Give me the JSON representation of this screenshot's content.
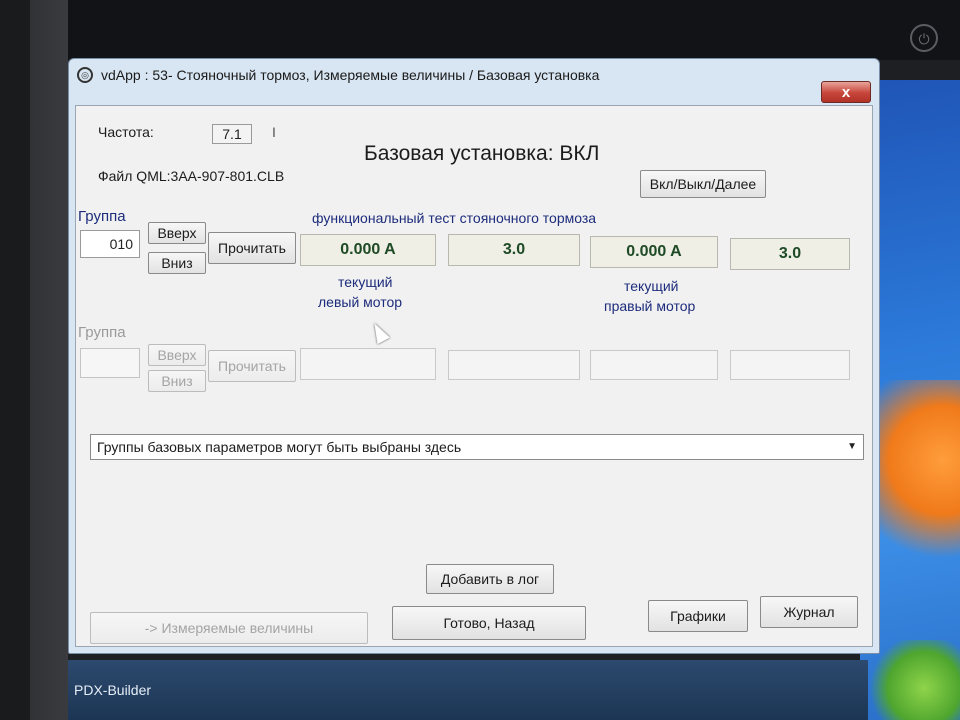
{
  "window": {
    "title": "vdApp : 53- Стояночный тормоз,  Измеряемые величины / Базовая установка",
    "close_label": "x"
  },
  "header": {
    "freq_label": "Частота:",
    "freq_value": "7.1",
    "freq_suffix": "I",
    "file_label": "Файл QML:3AA-907-801.CLB",
    "status_title": "Базовая установка: ВКЛ",
    "toggle_button": "Вкл/Выкл/Далее"
  },
  "group1": {
    "label": "Группа",
    "value": "010",
    "up_button": "Вверх",
    "down_button": "Вниз",
    "read_button": "Прочитать",
    "test_title": "функциональный тест стояночного тормоза",
    "values": [
      "0.000 A",
      "3.0",
      "0.000 A",
      "3.0"
    ],
    "caption_left": [
      "текущий",
      "левый мотор"
    ],
    "caption_right": [
      "текущий",
      "правый мотор"
    ]
  },
  "group2": {
    "label": "Группа",
    "value": "",
    "up_button": "Вверх",
    "down_button": "Вниз",
    "read_button": "Прочитать",
    "values": [
      "",
      "",
      "",
      ""
    ]
  },
  "dropdown": {
    "selected": "Группы базовых параметров могут быть выбраны здесь"
  },
  "footer": {
    "add_log_button": "Добавить в лог",
    "measured_button": "-> Измеряемые величины",
    "done_button": "Готово, Назад",
    "graphs_button": "Графики",
    "journal_button": "Журнал"
  },
  "taskbar": {
    "app_label": "PDX-Builder"
  }
}
